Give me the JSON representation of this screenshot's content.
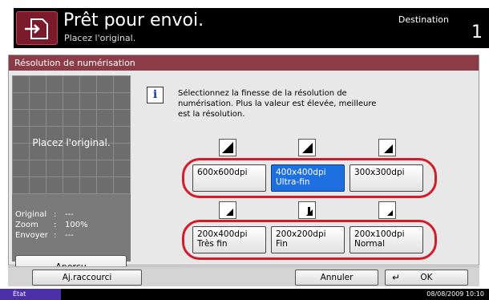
{
  "header": {
    "title": "Prêt pour envoi.",
    "subtitle": "Placez l'original.",
    "destination_label": "Destination",
    "destination_count": "1"
  },
  "panel": {
    "title": "Résolution de numérisation",
    "preview_text": "Placez l'original.",
    "info_rows": [
      {
        "key": "Original",
        "value": "---"
      },
      {
        "key": "Zoom",
        "value": "100%"
      },
      {
        "key": "Envoyer",
        "value": "---"
      }
    ],
    "preview_button": "Aperçu",
    "instruction": "Sélectionnez la finesse de la résolution de numérisation. Plus la valeur est élevée, meilleure est la résolution."
  },
  "options": [
    {
      "line1": "600x600dpi",
      "line2": "",
      "selected": false
    },
    {
      "line1": "400x400dpi",
      "line2": "Ultra-fin",
      "selected": true
    },
    {
      "line1": "300x300dpi",
      "line2": "",
      "selected": false
    },
    {
      "line1": "200x400dpi",
      "line2": "Très fin",
      "selected": false
    },
    {
      "line1": "200x200dpi",
      "line2": "Fin",
      "selected": false
    },
    {
      "line1": "200x100dpi",
      "line2": "Normal",
      "selected": false
    }
  ],
  "bottom": {
    "shortcut": "Aj.raccourci",
    "cancel": "Annuler",
    "ok": "OK"
  },
  "status": {
    "state": "État",
    "datetime": "08/08/2009   10:10"
  },
  "colors": {
    "accent": "#8c3b48",
    "selected": "#1e6fe0",
    "highlight": "#d31b2a"
  }
}
